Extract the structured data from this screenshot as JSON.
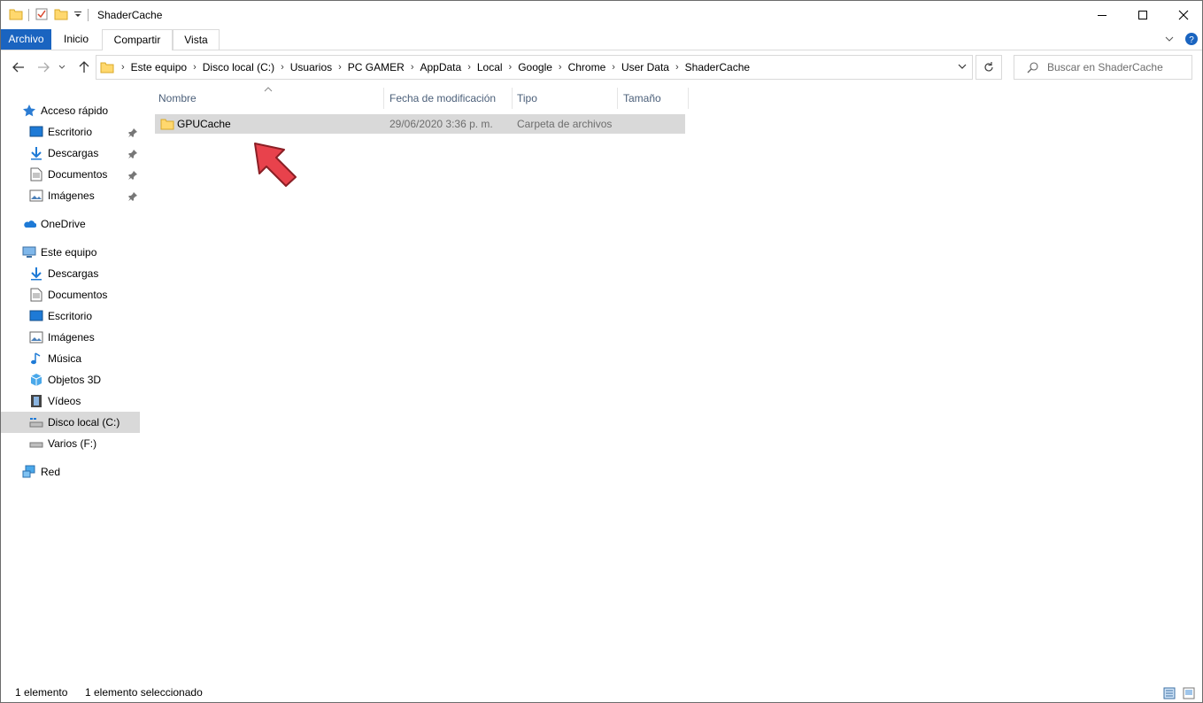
{
  "window": {
    "title": "ShaderCache"
  },
  "ribbon": {
    "tabs": [
      "Archivo",
      "Inicio",
      "Compartir",
      "Vista"
    ]
  },
  "address": {
    "crumbs": [
      "Este equipo",
      "Disco local (C:)",
      "Usuarios",
      "PC GAMER",
      "AppData",
      "Local",
      "Google",
      "Chrome",
      "User Data",
      "ShaderCache"
    ]
  },
  "search": {
    "placeholder": "Buscar en ShaderCache"
  },
  "sidebar": {
    "quick_access": "Acceso rápido",
    "quick_items": [
      "Escritorio",
      "Descargas",
      "Documentos",
      "Imágenes"
    ],
    "onedrive": "OneDrive",
    "this_pc": "Este equipo",
    "pc_items": [
      "Descargas",
      "Documentos",
      "Escritorio",
      "Imágenes",
      "Música",
      "Objetos 3D",
      "Vídeos",
      "Disco local (C:)",
      "Varios (F:)"
    ],
    "network": "Red"
  },
  "columns": {
    "name": "Nombre",
    "date": "Fecha de modificación",
    "type": "Tipo",
    "size": "Tamaño"
  },
  "files": [
    {
      "name": "GPUCache",
      "date": "29/06/2020 3:36 p. m.",
      "type": "Carpeta de archivos",
      "size": ""
    }
  ],
  "status": {
    "count": "1 elemento",
    "selected": "1 elemento seleccionado"
  },
  "colors": {
    "accent": "#1a64c0",
    "selection": "#d9d9d9",
    "arrow": "#e8424c",
    "folder": "#ffd86e"
  }
}
